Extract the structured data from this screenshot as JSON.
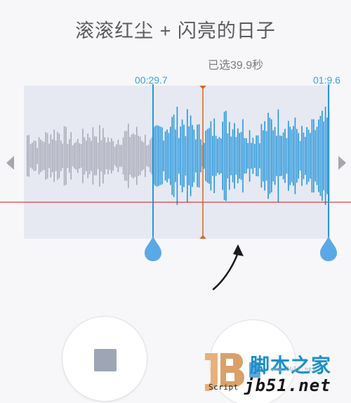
{
  "title": "滚滚红尘 + 闪亮的日子",
  "selection": {
    "duration_label": "已选39.9秒",
    "start_time": "00:29.7",
    "end_time": "01:9.6"
  },
  "colors": {
    "accent": "#2596dc",
    "unselected_wave": "#a8aab8",
    "playhead": "#d2691e",
    "guide_line": "#d9141a",
    "selection_bg": "#e6e9f2"
  },
  "icons": {
    "scroll_left": "triangle-left",
    "scroll_right": "triangle-right",
    "stop": "square",
    "left_handle": "drop",
    "right_handle": "drop",
    "annotation": "curved-arrow"
  },
  "controls": {
    "stop_button": "stop",
    "play_button": "play"
  },
  "watermark": {
    "logo_text": "JB",
    "script_text": "Script",
    "site_name": "脚本之家",
    "url": "www.Jb51.net",
    "domain": "jb51.net"
  }
}
